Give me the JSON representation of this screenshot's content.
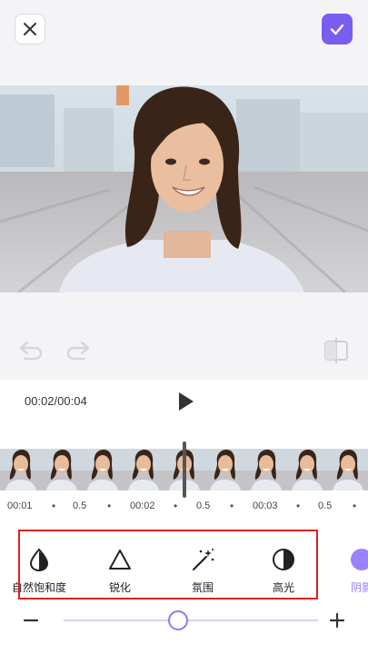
{
  "header": {
    "close_icon": "close-icon",
    "confirm_icon": "check-icon",
    "accent": "#7a5cf0"
  },
  "toolbar": {
    "undo_icon": "undo-icon",
    "redo_icon": "redo-icon",
    "compare_icon": "compare-icon"
  },
  "playback": {
    "time": "00:02/00:04",
    "play_icon": "play-icon"
  },
  "timeline": {
    "ruler": [
      "00:01",
      "0.5",
      "00:02",
      "0.5",
      "00:03",
      "0.5"
    ]
  },
  "tools": [
    {
      "label": "自然饱和度",
      "icon": "droplet-icon"
    },
    {
      "label": "锐化",
      "icon": "triangle-icon"
    },
    {
      "label": "氛围",
      "icon": "magic-wand-icon"
    },
    {
      "label": "高光",
      "icon": "half-circle-icon"
    },
    {
      "label": "阴影",
      "icon": "circle-icon"
    }
  ],
  "slider": {
    "minus": "−",
    "plus": "+",
    "value": 0.45
  }
}
